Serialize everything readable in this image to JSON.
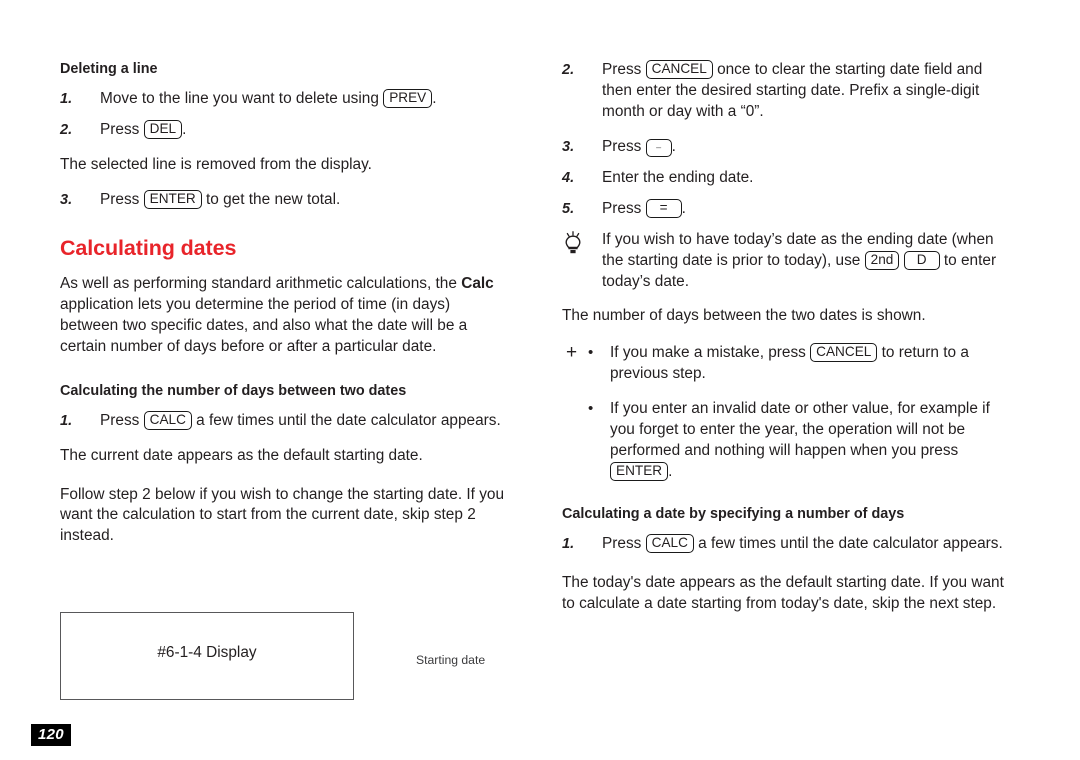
{
  "page": {
    "number": "120"
  },
  "left_column": {
    "heading_deleting": "Deleting a line",
    "step1_num": "1.",
    "step1_text_before": "Move to the line you want to delete using",
    "step1_key": "PREV",
    "step1_text_after": ".",
    "step2_num": "2.",
    "step2_text_before": "Press",
    "step2_key": "DEL",
    "step2_text_after": ".",
    "para_removed": "The selected line is removed from the display.",
    "step3_num": "3.",
    "step3_text_before": "Press",
    "step3_key": "ENTER",
    "step3_text_after": "to get the new total.",
    "heading_calculating_dates": "Calculating dates",
    "intro_part1": "As well as performing standard arithmetic calculations, the",
    "intro_bold": "Calc",
    "intro_part2": "application lets you determine the period of time (in days) between two specific dates, and also what the date will be a certain number of days before or after a particular date.",
    "heading_days_between": "Calculating the number of days between two dates",
    "calc_step1_num": "1.",
    "calc_step1_text_before": "Press",
    "calc_step1_key": "CALC",
    "calc_step1_text_after": "a few times until the date calculator appears.",
    "para_current_date": "The current date appears as the default starting date.",
    "para_follow_step": "Follow step 2 below if you wish to change the starting date. If you want the calculation to start from the current date, skip step 2 instead."
  },
  "figure": {
    "display_label": "#6-1-4 Display",
    "callout": "Starting date"
  },
  "right_column": {
    "step2_num": "2.",
    "step2_text_before": "Press",
    "step2_key": "CANCEL",
    "step2_text_after": "once to clear the starting date field and then enter the desired starting date. Prefix a single-digit month or day with a “0”.",
    "step3_num": "3.",
    "step3_text_before": "Press",
    "step3_key": "–",
    "step3_text_after": ".",
    "step4_num": "4.",
    "step4_text": "Enter the ending date.",
    "step5_num": "5.",
    "step5_text_before": "Press",
    "step5_key": "=",
    "step5_text_after": ".",
    "tip_icon": "lightbulb-icon",
    "tip_text_before": "If you wish to have today’s date as the ending date (when the starting date is prior to today), use",
    "tip_key_1": "2nd",
    "tip_key_2": "D",
    "tip_text_after": "to enter today’s date.",
    "para_days_shown": "The number of days between the two dates is shown.",
    "plus_marker": "+",
    "bullet_mark": "•",
    "bullet1_text_before": "If you make a mistake, press",
    "bullet1_key": "CANCEL",
    "bullet1_text_after": "to return to a previous step.",
    "bullet2_text_before": "If you enter an invalid date or other value, for example if you forget to enter the year, the operation will not be performed and nothing will happen when you press",
    "bullet2_key": "ENTER",
    "bullet2_text_after": ".",
    "heading_specify_days": "Calculating a date by specifying a number of days",
    "calc2_step1_num": "1.",
    "calc2_step1_text_before": "Press",
    "calc2_step1_key": "CALC",
    "calc2_step1_text_after": "a few times until the date calculator appears.",
    "para_todays_date": "The today's date appears as the default starting date. If you want to calculate a date starting from today's date, skip the next step."
  },
  "colors": {
    "heading_red": "#e8242a",
    "body_text": "#231f20",
    "figure_border": "#58585a",
    "page_badge_bg": "#000000"
  }
}
